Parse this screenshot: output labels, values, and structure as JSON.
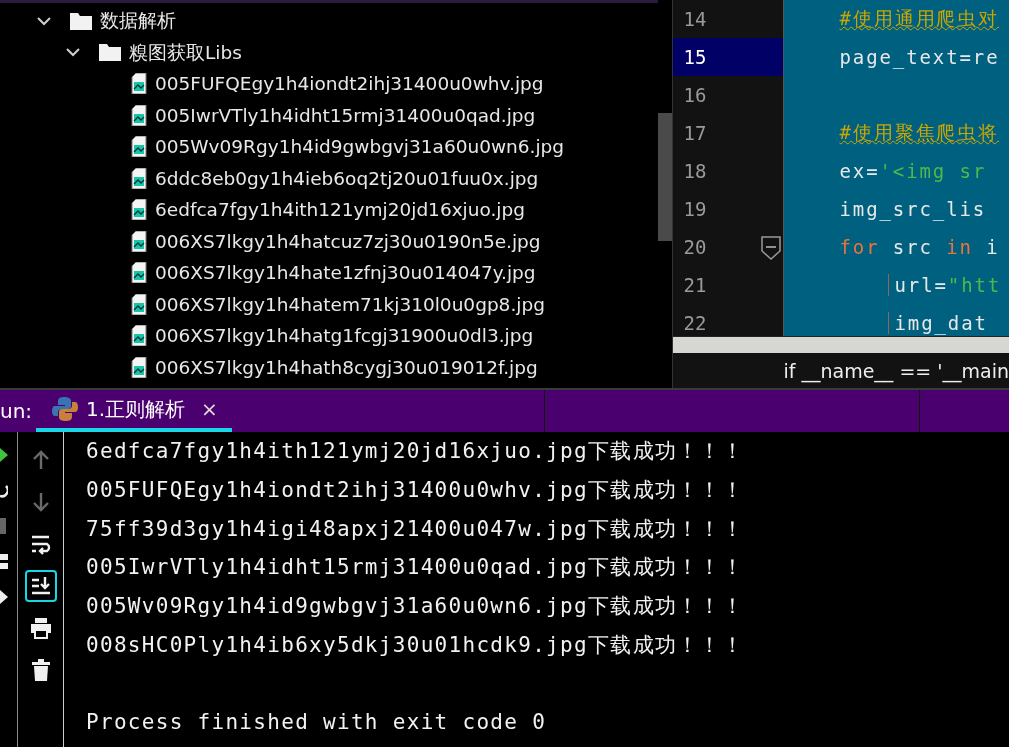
{
  "project_tree": {
    "items": [
      {
        "label": "数据解析",
        "kind": "folder",
        "expanded": true,
        "children": [
          {
            "label": "糗图获取Libs",
            "kind": "folder",
            "expanded": true,
            "children": [
              {
                "label": "005FUFQEgy1h4iondt2ihj31400u0whv.jpg",
                "kind": "image-file"
              },
              {
                "label": "005IwrVTly1h4idht15rmj31400u0qad.jpg",
                "kind": "image-file"
              },
              {
                "label": "005Wv09Rgy1h4id9gwbgvj31a60u0wn6.jpg",
                "kind": "image-file"
              },
              {
                "label": "6ddc8eb0gy1h4ieb6oq2tj20u01fuu0x.jpg",
                "kind": "image-file"
              },
              {
                "label": "6edfca7fgy1h4ith121ymj20jd16xjuo.jpg",
                "kind": "image-file"
              },
              {
                "label": "006XS7lkgy1h4hatcuz7zj30u0190n5e.jpg",
                "kind": "image-file"
              },
              {
                "label": "006XS7lkgy1h4hate1zfnj30u014047y.jpg",
                "kind": "image-file"
              },
              {
                "label": "006XS7lkgy1h4hatem71kj310l0u0gp8.jpg",
                "kind": "image-file"
              },
              {
                "label": "006XS7lkgy1h4hatg1fcgj31900u0dl3.jpg",
                "kind": "image-file"
              },
              {
                "label": "006XS7lkgy1h4hath8cygj30u019012f.jpg",
                "kind": "image-file"
              }
            ]
          }
        ]
      }
    ]
  },
  "editor": {
    "lines": [
      {
        "number": "14",
        "selected": false,
        "tokens": [
          {
            "text": "#使用通用爬虫对",
            "kind": "comment"
          }
        ]
      },
      {
        "number": "15",
        "selected": true,
        "tokens": [
          {
            "text": "page_text=re",
            "kind": "plain"
          }
        ]
      },
      {
        "number": "16",
        "selected": false
      },
      {
        "number": "17",
        "selected": false,
        "tokens": [
          {
            "text": "#使用聚焦爬虫将",
            "kind": "comment"
          }
        ]
      },
      {
        "number": "18",
        "selected": false,
        "tokens": [
          {
            "text": "ex=",
            "kind": "plain"
          },
          {
            "text": "'<img sr",
            "kind": "string"
          }
        ]
      },
      {
        "number": "19",
        "selected": false,
        "tokens": [
          {
            "text": "img_src_lis",
            "kind": "plain"
          }
        ]
      },
      {
        "number": "20",
        "selected": false,
        "tokens": [
          {
            "text": "for",
            "kind": "keyword"
          },
          {
            "text": " src ",
            "kind": "plain"
          },
          {
            "text": "in",
            "kind": "keyword"
          },
          {
            "text": " i",
            "kind": "plain"
          }
        ],
        "children": [
          {
            "number": "21",
            "selected": false,
            "tokens": [
              {
                "text": "url=",
                "kind": "plain"
              },
              {
                "text": "\"htt",
                "kind": "string"
              }
            ]
          },
          {
            "number": "22",
            "selected": false,
            "tokens": [
              {
                "text": "img_dat",
                "kind": "plain"
              }
            ]
          }
        ]
      }
    ],
    "breadcrumb": "if __name__ == '__main"
  },
  "run_panel": {
    "label": "un:",
    "tabs": [
      {
        "label": "1.正则解析",
        "selected": true,
        "close": "×"
      }
    ],
    "tools": [
      {
        "kind": "up",
        "on": false,
        "disabled": true
      },
      {
        "kind": "down",
        "on": false,
        "disabled": true
      },
      {
        "kind": "wrap",
        "on": false,
        "disabled": false
      },
      {
        "kind": "scroll-end",
        "on": true,
        "disabled": false
      },
      {
        "kind": "print",
        "on": false,
        "disabled": false
      },
      {
        "kind": "trash",
        "on": false,
        "disabled": false
      }
    ],
    "output": [
      "6edfca7fgy1h4ith121ymj20jd16xjuo.jpg下载成功！！！",
      "005FUFQEgy1h4iondt2ihj31400u0whv.jpg下载成功！！！",
      "75ff39d3gy1h4igi48apxj21400u047w.jpg下载成功！！！",
      "005IwrVTly1h4idht15rmj31400u0qad.jpg下载成功！！！",
      "005Wv09Rgy1h4id9gwbgvj31a60u0wn6.jpg下载成功！！！",
      "008sHC0Ply1h4ib6xy5dkj30u01hcdk9.jpg下载成功！！！"
    ],
    "exit_message": "Process finished with exit code 0"
  }
}
